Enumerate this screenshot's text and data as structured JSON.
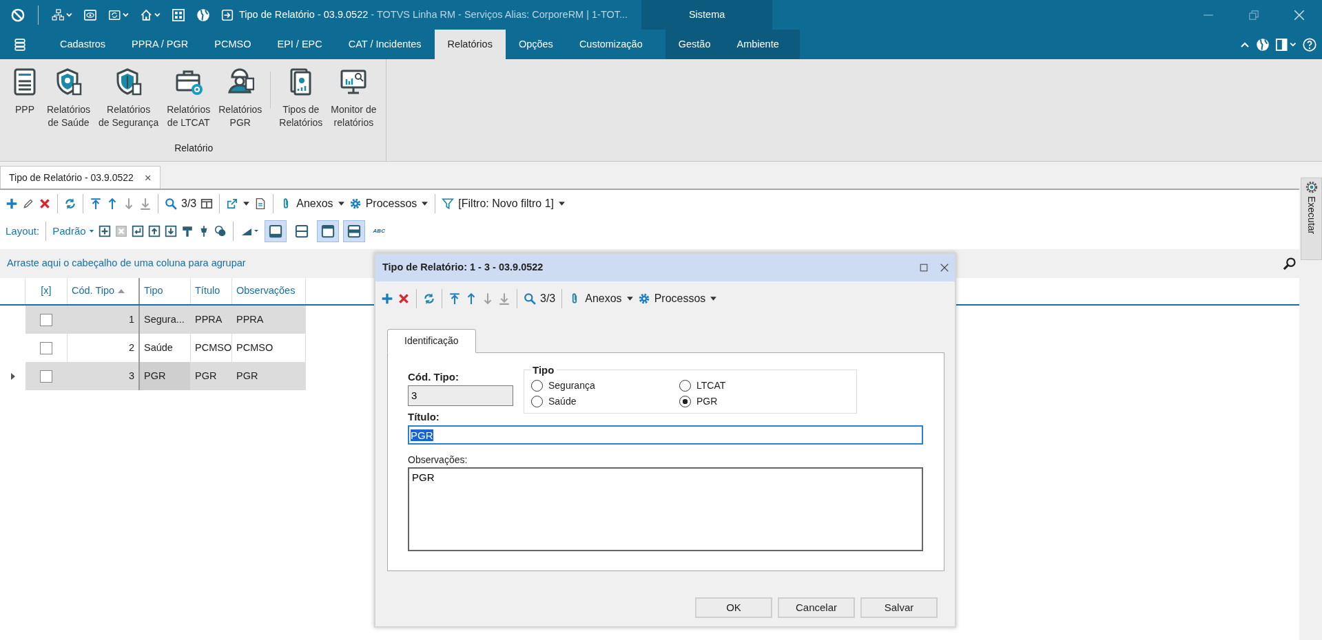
{
  "title_bar": {
    "title": "Tipo de Relatório - 03.9.0522",
    "subtitle": "- TOTVS Linha RM - Serviços  Alias: CorporeRM | 1-TOT...",
    "context_header": "Sistema"
  },
  "menu_tabs": [
    {
      "label": "Cadastros",
      "selected": false,
      "kind": "normal"
    },
    {
      "label": "PPRA / PGR",
      "selected": false,
      "kind": "normal"
    },
    {
      "label": "PCMSO",
      "selected": false,
      "kind": "normal"
    },
    {
      "label": "EPI / EPC",
      "selected": false,
      "kind": "normal"
    },
    {
      "label": "CAT / Incidentes",
      "selected": false,
      "kind": "normal"
    },
    {
      "label": "Relatórios",
      "selected": true,
      "kind": "normal"
    },
    {
      "label": "Opções",
      "selected": false,
      "kind": "normal"
    },
    {
      "label": "Customização",
      "selected": false,
      "kind": "normal"
    },
    {
      "label": "Gestão",
      "selected": false,
      "kind": "context"
    },
    {
      "label": "Ambiente",
      "selected": false,
      "kind": "context"
    }
  ],
  "ribbon": {
    "group_label": "Relatório",
    "buttons": [
      {
        "lines": [
          "PPP"
        ],
        "separator_before": false
      },
      {
        "lines": [
          "Relatórios",
          "de Saúde"
        ],
        "separator_before": false
      },
      {
        "lines": [
          "Relatórios",
          "de Segurança"
        ],
        "separator_before": false
      },
      {
        "lines": [
          "Relatórios",
          "de LTCAT"
        ],
        "separator_before": false
      },
      {
        "lines": [
          "Relatórios",
          "PGR"
        ],
        "separator_before": false
      },
      {
        "lines": [
          "Tipos de",
          "Relatórios"
        ],
        "separator_before": true
      },
      {
        "lines": [
          "Monitor de",
          "relatórios"
        ],
        "separator_before": false
      }
    ]
  },
  "document_tab": {
    "label": "Tipo de Relatório - 03.9.0522",
    "close": "×"
  },
  "toolbar": {
    "navigation": [
      {
        "disabled": false
      },
      {
        "disabled": false
      },
      {
        "disabled": true
      },
      {
        "disabled": true
      }
    ],
    "counter": "3/3",
    "attachments": "Anexos",
    "processes": "Processos",
    "filter": "[Filtro: Novo filtro 1]"
  },
  "layout_toolbar": {
    "label": "Layout:",
    "layout": "Padrão",
    "view_toggles": [
      {
        "selected": true
      },
      {
        "selected": false
      },
      {
        "selected": true
      },
      {
        "selected": true
      }
    ],
    "abc": "ABC"
  },
  "group_panel": {
    "hint": "Arraste aqui o cabeçalho de uma coluna para agrupar"
  },
  "grid": {
    "columns": [
      {
        "label": "[x]",
        "sorted": false
      },
      {
        "label": "Cód. Tipo",
        "sorted": true
      },
      {
        "label": "Tipo",
        "sorted": false
      },
      {
        "label": "Título",
        "sorted": false
      },
      {
        "label": "Observações",
        "sorted": false
      }
    ],
    "rows": [
      {
        "checked": false,
        "current": false,
        "code": "1",
        "type": "Segura...",
        "title": "PPRA",
        "notes": "PPRA"
      },
      {
        "checked": false,
        "current": false,
        "code": "2",
        "type": "Saúde",
        "title": "PCMSO",
        "notes": "PCMSO"
      },
      {
        "checked": false,
        "current": true,
        "code": "3",
        "type": "PGR",
        "title": "PGR",
        "notes": "PGR"
      }
    ]
  },
  "side_panel": {
    "label": "Executar"
  },
  "dialog": {
    "title": "Tipo de Relatório: 1 - 3 - 03.9.0522",
    "toolbar": {
      "navigation": [
        {
          "disabled": false
        },
        {
          "disabled": false
        },
        {
          "disabled": true
        },
        {
          "disabled": true
        }
      ],
      "counter": "3/3",
      "attachments": "Anexos",
      "processes": "Processos"
    },
    "tabs": [
      {
        "label": "Identificação",
        "selected": true
      }
    ],
    "code_label": "Cód. Tipo:",
    "code_value": "3",
    "type_group": {
      "label": "Tipo",
      "options": [
        {
          "label": "Segurança",
          "selected": false
        },
        {
          "label": "LTCAT",
          "selected": false
        },
        {
          "label": "Saúde",
          "selected": false
        },
        {
          "label": "PGR",
          "selected": true
        }
      ]
    },
    "title_label": "Título:",
    "title_value": "PGR",
    "notes_label": "Observações:",
    "notes_value": "PGR",
    "buttons": [
      "OK",
      "Cancelar",
      "Salvar"
    ]
  }
}
